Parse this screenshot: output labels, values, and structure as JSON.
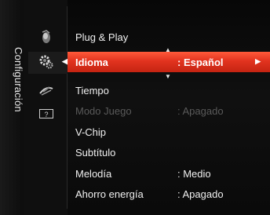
{
  "menu": {
    "title": "Configuración",
    "icons": [
      {
        "name": "picture-icon",
        "selected": false
      },
      {
        "name": "setup-gear-icon",
        "selected": true
      },
      {
        "name": "satellite-dish-icon",
        "selected": false
      },
      {
        "name": "help-question-icon",
        "selected": false,
        "text": "?"
      }
    ],
    "items": [
      {
        "label": "Plug & Play",
        "value": "",
        "state": "normal"
      },
      {
        "label": "Idioma",
        "value": ": Español",
        "state": "selected"
      },
      {
        "label": "Tiempo",
        "value": "",
        "state": "normal"
      },
      {
        "label": "Modo Juego",
        "value": ": Apagado",
        "state": "disabled"
      },
      {
        "label": "V-Chip",
        "value": "",
        "state": "normal"
      },
      {
        "label": "Subtítulo",
        "value": "",
        "state": "normal"
      },
      {
        "label": "Melodía",
        "value": ": Medio",
        "state": "normal"
      },
      {
        "label": "Ahorro energía",
        "value": ": Apagado",
        "state": "normal"
      }
    ]
  },
  "colors": {
    "highlight": "#e2331f",
    "text": "#f0f0f0",
    "disabled_text": "#5a5a5a",
    "background": "#0a0a0a"
  }
}
